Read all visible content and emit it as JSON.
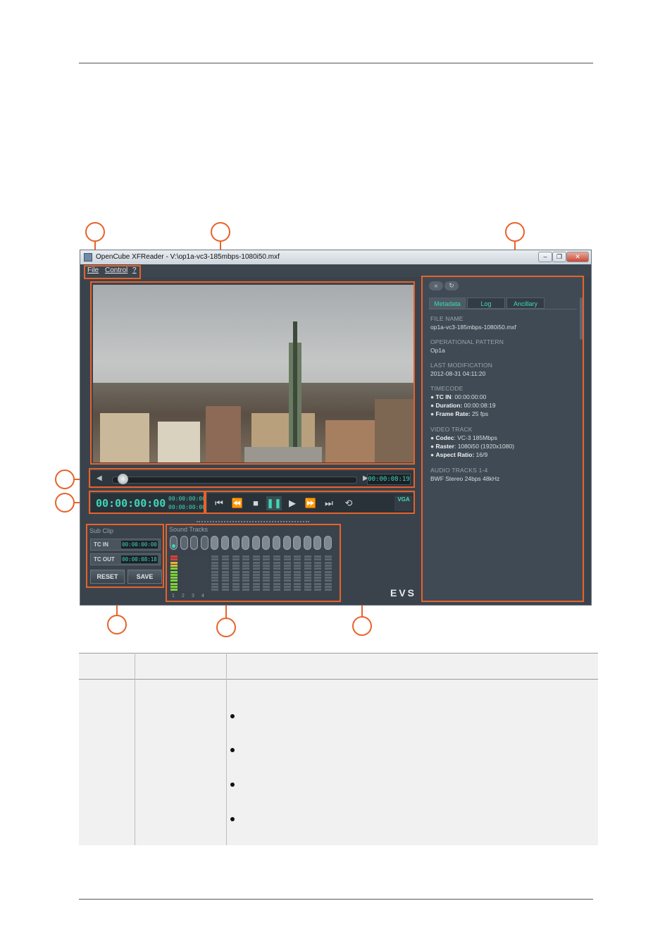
{
  "window": {
    "title": "OpenCube XFReader - V:\\op1a-vc3-185mbps-1080i50.mxf",
    "controls": [
      "–",
      "❐",
      "✕"
    ]
  },
  "menu": [
    "File",
    "Control",
    "?"
  ],
  "seek": {
    "timecode": "00:00:08:19"
  },
  "timecode": {
    "main": "00:00:00:00",
    "in": "00:00:00:00",
    "out": "00:00:00:00"
  },
  "transport": {
    "vga_label": "VGA"
  },
  "subclip": {
    "title": "Sub Clip",
    "tc_in_label": "TC IN",
    "tc_in_value": "00:00:00:00",
    "tc_out_label": "TC OUT",
    "tc_out_value": "00:00:08:18",
    "reset_label": "RESET",
    "save_label": "SAVE"
  },
  "sound": {
    "title": "Sound Tracks",
    "track_numbers": [
      "1",
      "2",
      "3",
      "4"
    ]
  },
  "brand": "EVS",
  "metadata": {
    "tabs": [
      "Metadata",
      "Log",
      "Ancillary"
    ],
    "file_name_head": "FILE NAME",
    "file_name": "op1a-vc3-185mbps-1080i50.mxf",
    "op_head": "OPERATIONAL PATTERN",
    "op": "Op1a",
    "lastmod_head": "LAST MODIFICATION",
    "lastmod": "2012-08-31 04:11:20",
    "timecode_head": "TIMECODE",
    "tc_in_label": "TC IN",
    "tc_in": ": 00:00:00:00",
    "duration_label": "Duration:",
    "duration": " 00:00:08:19",
    "frame_rate_label": "Frame Rate:",
    "frame_rate": " 25 fps",
    "video_head": "VIDEO TRACK",
    "codec_label": "Codec",
    "codec": ": VC-3 185Mbps",
    "raster_label": "Raster",
    "raster": ": 1080i50 (1920x1080)",
    "aspect_label": "Aspect Ratio:",
    "aspect": " 16/9",
    "audio_head": "AUDIO TRACKS 1-4",
    "audio": "BWF Stereo 24bps 48kHz"
  }
}
